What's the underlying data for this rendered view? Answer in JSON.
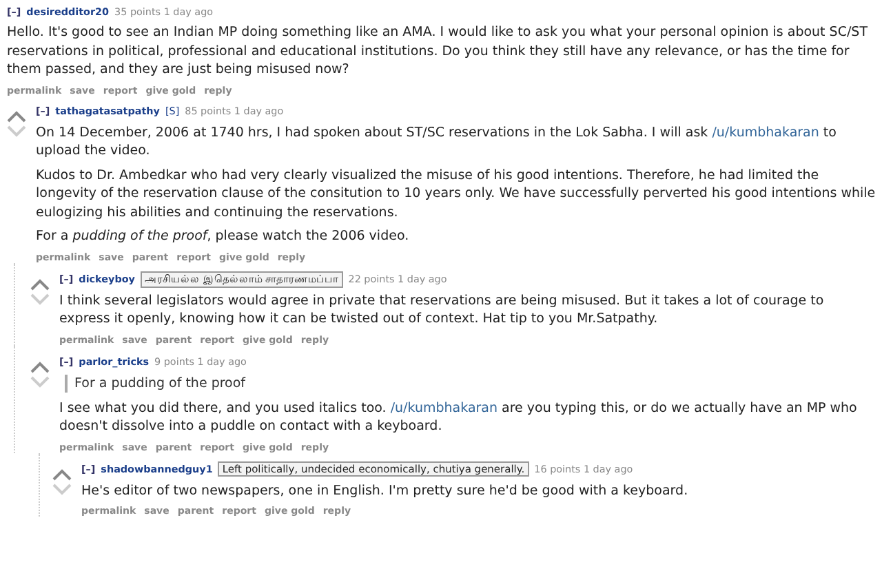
{
  "comments": [
    {
      "collapse": "[–]",
      "author": "desiredditor20",
      "score_time": "35 points 1 day ago",
      "vote_arrows": false,
      "paragraphs": [
        {
          "kind": "text",
          "parts": [
            {
              "kind": "text",
              "text": "Hello. It's good to see an Indian MP doing something like an AMA. I would like to ask you what your personal opinion is about SC/ST reservations in political, professional and educational institutions. Do you think they still have any relevance, or has the time for them passed, and they are just being misused now?"
            }
          ]
        }
      ],
      "actions": [
        "permalink",
        "save",
        "report",
        "give gold",
        "reply"
      ],
      "children": [
        {
          "collapse": "[–]",
          "author": "tathagatasatpathy",
          "submitter": "[S]",
          "score_time": "85 points 1 day ago",
          "vote_arrows": true,
          "paragraphs": [
            {
              "kind": "text",
              "parts": [
                {
                  "kind": "text",
                  "text": "On 14 December, 2006 at 1740 hrs, I had spoken about ST/SC reservations in the Lok Sabha. I will ask "
                },
                {
                  "kind": "link",
                  "text": "/u/kumbhakaran"
                },
                {
                  "kind": "text",
                  "text": " to upload the video."
                }
              ]
            },
            {
              "kind": "text",
              "parts": [
                {
                  "kind": "text",
                  "text": "Kudos to Dr. Ambedkar who had very clearly visualized the misuse of his good intentions. Therefore, he had limited the longevity of the reservation clause of the consitution to 10 years only. We have successfully perverted his good intentions while eulogizing his abilities and continuing the reservations."
                }
              ]
            },
            {
              "kind": "text",
              "parts": [
                {
                  "kind": "text",
                  "text": "For a *pudding of the proof*, please watch the 2006 video."
                }
              ]
            }
          ],
          "actions": [
            "permalink",
            "save",
            "parent",
            "report",
            "give gold",
            "reply"
          ],
          "children": [
            {
              "collapse": "[–]",
              "author": "dickeyboy",
              "flair": "அரசியல்ல இதெல்லாம் சாதாரணமப்பா",
              "score_time": "22 points 1 day ago",
              "vote_arrows": true,
              "paragraphs": [
                {
                  "kind": "text",
                  "parts": [
                    {
                      "kind": "text",
                      "text": "I think several legislators would agree in private that reservations are being misused. But it takes a lot of courage to express it openly, knowing how it can be twisted out of context. Hat tip to you Mr.Satpathy."
                    }
                  ]
                }
              ],
              "actions": [
                "permalink",
                "save",
                "parent",
                "report",
                "give gold",
                "reply"
              ]
            },
            {
              "collapse": "[–]",
              "author": "parlor_tricks",
              "score_time": "9 points 1 day ago",
              "vote_arrows": true,
              "paragraphs": [
                {
                  "kind": "quote",
                  "parts": [
                    {
                      "kind": "text",
                      "text": "For a pudding of the proof"
                    }
                  ]
                },
                {
                  "kind": "text",
                  "parts": [
                    {
                      "kind": "text",
                      "text": "I see what you did there, and you used italics too. "
                    },
                    {
                      "kind": "link",
                      "text": "/u/kumbhakaran"
                    },
                    {
                      "kind": "text",
                      "text": " are you typing this, or do we actually have an MP who doesn't dissolve into a puddle on contact with a keyboard."
                    }
                  ]
                }
              ],
              "actions": [
                "permalink",
                "save",
                "parent",
                "report",
                "give gold",
                "reply"
              ],
              "children": [
                {
                  "collapse": "[–]",
                  "author": "shadowbannedguy1",
                  "flair": "Left politically, undecided economically, chutiya generally.",
                  "score_time": "16 points 1 day ago",
                  "vote_arrows": true,
                  "paragraphs": [
                    {
                      "kind": "text",
                      "parts": [
                        {
                          "kind": "text",
                          "text": "He's editor of two newspapers, one in English. I'm pretty sure he'd be good with a keyboard."
                        }
                      ]
                    }
                  ],
                  "actions": [
                    "permalink",
                    "save",
                    "parent",
                    "report",
                    "give gold",
                    "reply"
                  ]
                }
              ]
            }
          ]
        }
      ]
    }
  ]
}
